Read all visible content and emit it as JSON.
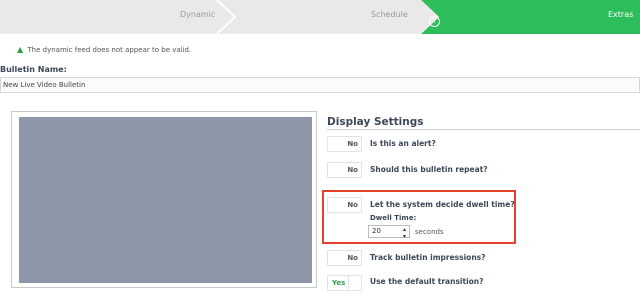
{
  "wizard": {
    "steps": [
      {
        "label": "Dynamic",
        "state": "inactive"
      },
      {
        "label": "Schedule",
        "state": "inactive"
      },
      {
        "label": "Extras",
        "state": "active"
      }
    ],
    "help_icon": "?",
    "active_color": "#2ebd5b",
    "inactive_color": "#e9e9e9"
  },
  "warning": {
    "icon": "warning-triangle-icon",
    "text": "The dynamic feed does not appear to be valid."
  },
  "bulletin_name": {
    "label": "Bulletin Name:",
    "value": "New Live Video Bulletin"
  },
  "display_settings": {
    "heading": "Display Settings",
    "items": [
      {
        "toggle": "No",
        "label": "Is this an alert?"
      },
      {
        "toggle": "No",
        "label": "Should this bulletin repeat?"
      },
      {
        "toggle": "No",
        "label": "Let the system decide dwell time?"
      },
      {
        "toggle": "No",
        "label": "Track bulletin impressions?"
      },
      {
        "toggle": "Yes",
        "label": "Use the default transition?"
      }
    ],
    "dwell": {
      "label": "Dwell Time:",
      "value": "20",
      "unit": "seconds"
    },
    "highlight_color": "#e2412d"
  },
  "preview": {
    "fill_color": "#8e96aa"
  }
}
